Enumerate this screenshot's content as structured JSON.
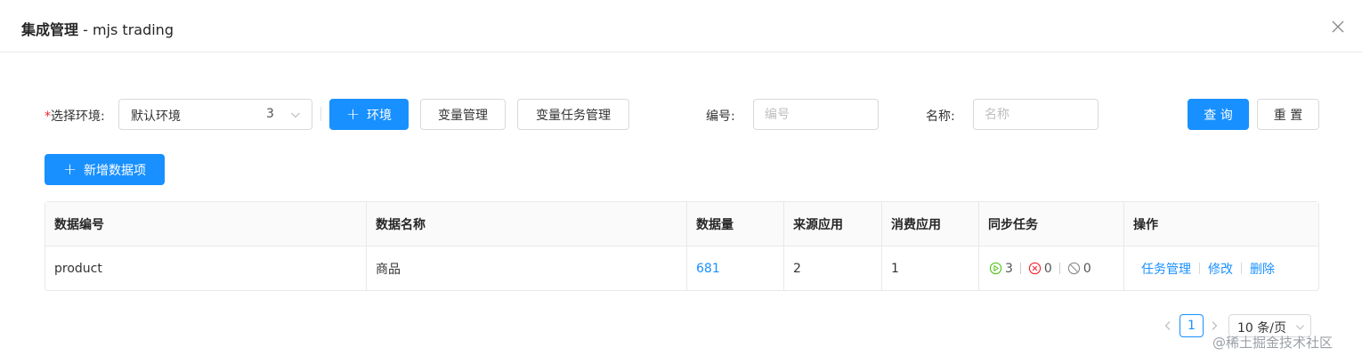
{
  "header": {
    "title_strong": "集成管理",
    "title_rest": " - mjs trading"
  },
  "filters": {
    "env_required_mark": "*",
    "env_label": "选择环境:",
    "env_value": "默认环境",
    "env_count": "3",
    "add_env_label": "环境",
    "var_manage_label": "变量管理",
    "var_task_manage_label": "变量任务管理",
    "code_label": "编号:",
    "code_placeholder": "编号",
    "name_label": "名称:",
    "name_placeholder": "名称",
    "query_label": "查 询",
    "reset_label": "重 置"
  },
  "toolbar": {
    "add_item_label": "新增数据项"
  },
  "table": {
    "columns": [
      "数据编号",
      "数据名称",
      "数据量",
      "来源应用",
      "消费应用",
      "同步任务",
      "操作"
    ],
    "rows": [
      {
        "code": "product",
        "name": "商品",
        "count": "681",
        "source_apps": "2",
        "consumer_apps": "1",
        "tasks_running": "3",
        "tasks_failed": "0",
        "tasks_disabled": "0",
        "actions": [
          "任务管理",
          "修改",
          "删除"
        ]
      }
    ]
  },
  "pagination": {
    "current_page": "1",
    "page_size": "10 条/页"
  },
  "watermark": "@稀土掘金技术社区",
  "colors": {
    "primary": "#1890ff",
    "success": "#52c41a",
    "danger": "#f5222d",
    "muted": "#8c8c8c"
  }
}
